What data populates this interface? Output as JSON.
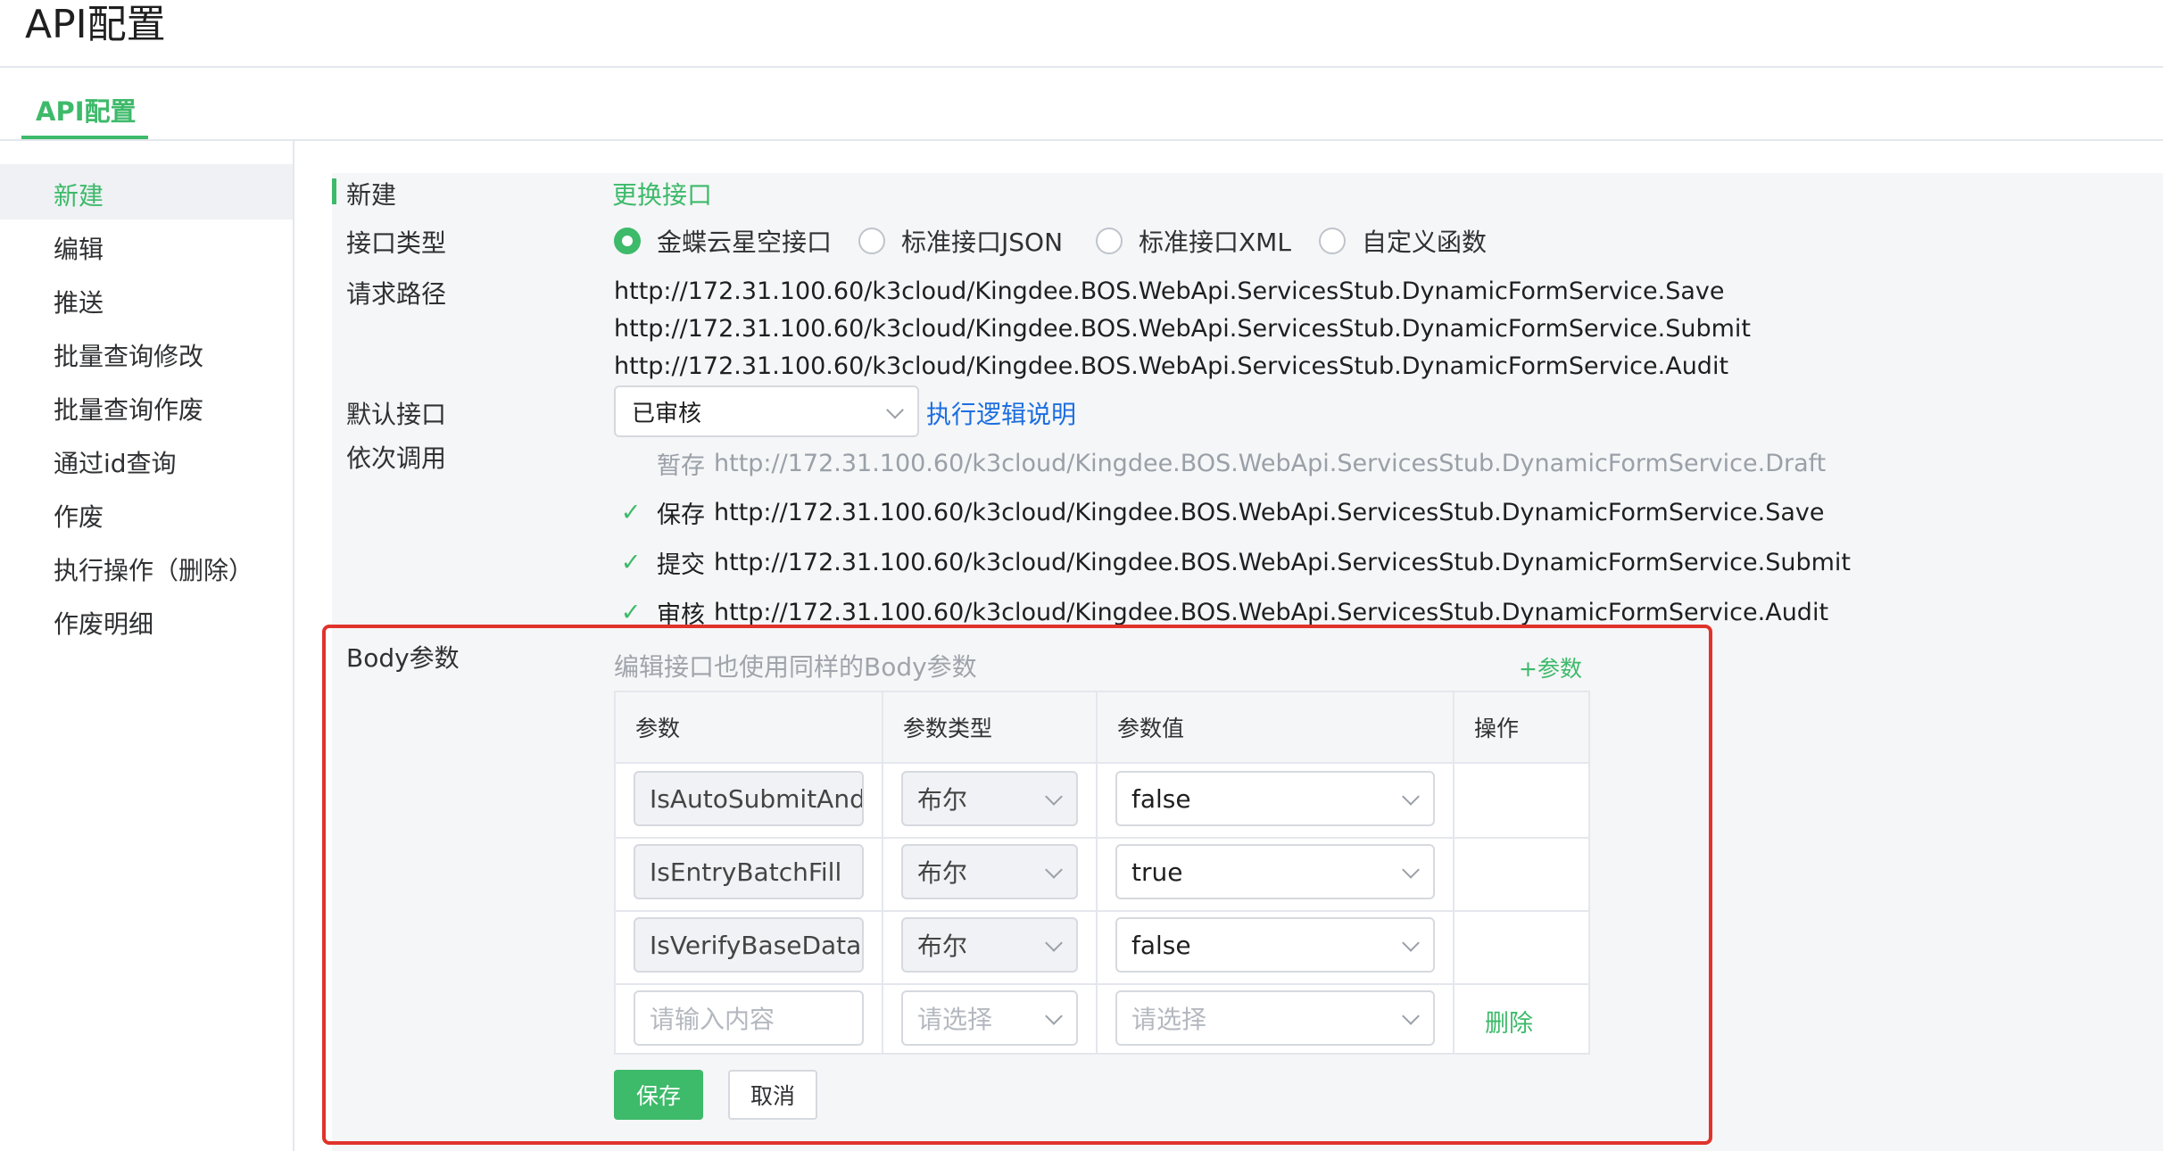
{
  "header": {
    "title": "API配置"
  },
  "tabs": [
    {
      "label": "API配置"
    }
  ],
  "sidebar": {
    "items": [
      {
        "label": "新建"
      },
      {
        "label": "编辑"
      },
      {
        "label": "推送"
      },
      {
        "label": "批量查询修改"
      },
      {
        "label": "批量查询作废"
      },
      {
        "label": "通过id查询"
      },
      {
        "label": "作废"
      },
      {
        "label": "执行操作（删除）"
      },
      {
        "label": "作废明细"
      }
    ]
  },
  "form": {
    "section_label": "新建",
    "change_interface": "更换接口",
    "interface_type_label": "接口类型",
    "interface_types": [
      {
        "label": "金蝶云星空接口",
        "selected": true
      },
      {
        "label": "标准接口JSON",
        "selected": false
      },
      {
        "label": "标准接口XML",
        "selected": false
      },
      {
        "label": "自定义函数",
        "selected": false
      }
    ],
    "request_path_label": "请求路径",
    "request_paths": [
      "http://172.31.100.60/k3cloud/Kingdee.BOS.WebApi.ServicesStub.DynamicFormService.Save",
      "http://172.31.100.60/k3cloud/Kingdee.BOS.WebApi.ServicesStub.DynamicFormService.Submit",
      "http://172.31.100.60/k3cloud/Kingdee.BOS.WebApi.ServicesStub.DynamicFormService.Audit"
    ],
    "default_interface_label": "默认接口",
    "default_interface_value": "已审核",
    "logic_link": "执行逻辑说明",
    "sequence_label": "依次调用",
    "sequence": [
      {
        "name": "暂存",
        "url": "http://172.31.100.60/k3cloud/Kingdee.BOS.WebApi.ServicesStub.DynamicFormService.Draft",
        "checked": false
      },
      {
        "name": "保存",
        "url": "http://172.31.100.60/k3cloud/Kingdee.BOS.WebApi.ServicesStub.DynamicFormService.Save",
        "checked": true
      },
      {
        "name": "提交",
        "url": "http://172.31.100.60/k3cloud/Kingdee.BOS.WebApi.ServicesStub.DynamicFormService.Submit",
        "checked": true
      },
      {
        "name": "审核",
        "url": "http://172.31.100.60/k3cloud/Kingdee.BOS.WebApi.ServicesStub.DynamicFormService.Audit",
        "checked": true
      }
    ],
    "check_glyph": "✓",
    "body_label": "Body参数",
    "body_hint": "编辑接口也使用同样的Body参数",
    "add_param": "+参数",
    "table": {
      "headers": [
        "参数",
        "参数类型",
        "参数值",
        "操作"
      ],
      "rows": [
        {
          "param": "IsAutoSubmitAndAudit",
          "type": "布尔",
          "value": "false"
        },
        {
          "param": "IsEntryBatchFill",
          "type": "布尔",
          "value": "true"
        },
        {
          "param": "IsVerifyBaseDataField",
          "type": "布尔",
          "value": "false"
        }
      ],
      "new_row": {
        "param_placeholder": "请输入内容",
        "type_placeholder": "请选择",
        "value_placeholder": "请选择",
        "delete_label": "删除"
      }
    },
    "save_button": "保存",
    "cancel_button": "取消"
  },
  "colors": {
    "accent": "#3dba6a",
    "link": "#1d6fe0",
    "highlight": "#e0332b"
  }
}
